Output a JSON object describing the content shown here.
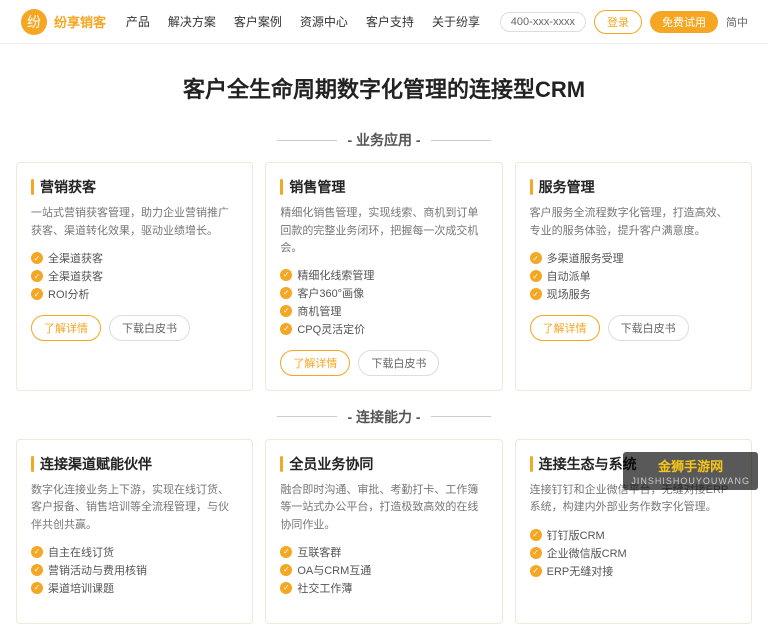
{
  "header": {
    "logo_text": "纷享销客",
    "nav_items": [
      "产品",
      "解决方案",
      "客户案例",
      "资源中心",
      "客户支持",
      "关于纷享"
    ],
    "phone_label": "400-xxx-xxxx",
    "login_label": "登录",
    "trial_label": "免费试用",
    "lang_label": "简中"
  },
  "hero": {
    "title": "客户全生命周期数字化管理的连接型CRM"
  },
  "section1": {
    "title": "- 业务应用 -"
  },
  "section2": {
    "title": "- 连接能力 -"
  },
  "cards_biz": [
    {
      "title": "营销获客",
      "desc": "一站式营销获客管理，助力企业营销推广获客、渠道转化效果，驱动业绩增长。",
      "features": [
        "全渠道获客",
        "全渠道获客",
        "ROI分析"
      ],
      "btn1": "了解详情",
      "btn2": "下载白皮书"
    },
    {
      "title": "销售管理",
      "desc": "精细化销售管理，实现线索、商机到订单回款的完整业务闭环，把握每一次成交机会。",
      "features": [
        "精细化线索管理",
        "客户360°画像",
        "商机管理",
        "CPQ灵活定价"
      ],
      "btn1": "了解详情",
      "btn2": "下载白皮书"
    },
    {
      "title": "服务管理",
      "desc": "客户服务全流程数字化管理，打造高效、专业的服务体验，提升客户满意度。",
      "features": [
        "多渠道服务受理",
        "自动派单",
        "现场服务"
      ],
      "btn1": "了解详情",
      "btn2": "下载白皮书"
    }
  ],
  "cards_connect": [
    {
      "title": "连接渠道赋能伙伴",
      "desc": "数字化连接业务上下游，实现在线订货、客户报备、销售培训等全流程管理，与伙伴共创共赢。",
      "features": [
        "自主在线订货",
        "营销活动与费用核销",
        "渠道培训课题"
      ],
      "btn1": "",
      "btn2": ""
    },
    {
      "title": "全员业务协同",
      "desc": "融合即时沟通、审批、考勤打卡、工作簿等一站式办公平台，打造极致高效的在线协同作业。",
      "features": [
        "互联客群",
        "OA与CRM互通",
        "社交工作薄"
      ],
      "btn1": "",
      "btn2": ""
    },
    {
      "title": "连接生态与系统",
      "desc": "连接钉钉和企业微信平台，无缝对接ERP系统，构建内外部业务作数字化管理。",
      "features": [
        "钉钉版CRM",
        "企业微信版CRM",
        "ERP无缝对接"
      ],
      "btn1": "",
      "btn2": ""
    }
  ],
  "watermark": {
    "main": "金狮手游网",
    "sub": "JINSHISHOUYOUWANG"
  }
}
